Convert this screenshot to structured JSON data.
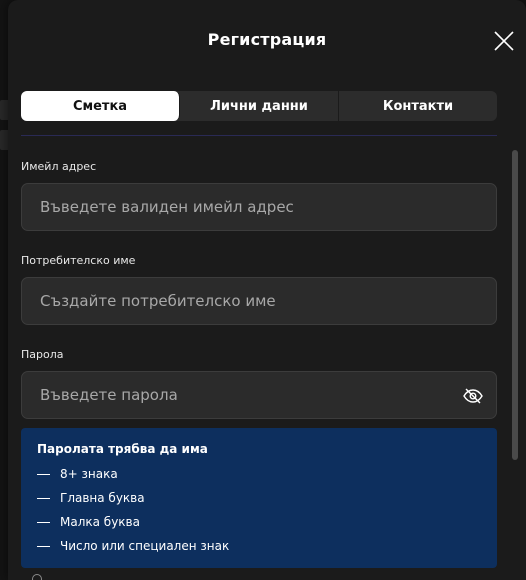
{
  "modal": {
    "title": "Регистрация",
    "tabs": [
      {
        "label": "Сметка",
        "active": true
      },
      {
        "label": "Лични данни",
        "active": false
      },
      {
        "label": "Контакти",
        "active": false
      }
    ],
    "fields": {
      "email": {
        "label": "Имейл адрес",
        "placeholder": "Въведете валиден имейл адрес"
      },
      "username": {
        "label": "Потребителско име",
        "placeholder": "Създайте потребителско име"
      },
      "password": {
        "label": "Парола",
        "placeholder": "Въведете парола"
      }
    },
    "password_requirements": {
      "title": "Паролата трябва да има",
      "items": [
        "8+ знака",
        "Главна буква",
        "Малка буква",
        "Число или специален знак"
      ]
    }
  },
  "icons": {
    "close": "close-icon",
    "eye": "eye-off-icon"
  },
  "colors": {
    "background": "#1b1b1b",
    "input_bg": "#2b2b2b",
    "active_tab_bg": "#ffffff",
    "requirements_bg": "#0d2f5e"
  }
}
